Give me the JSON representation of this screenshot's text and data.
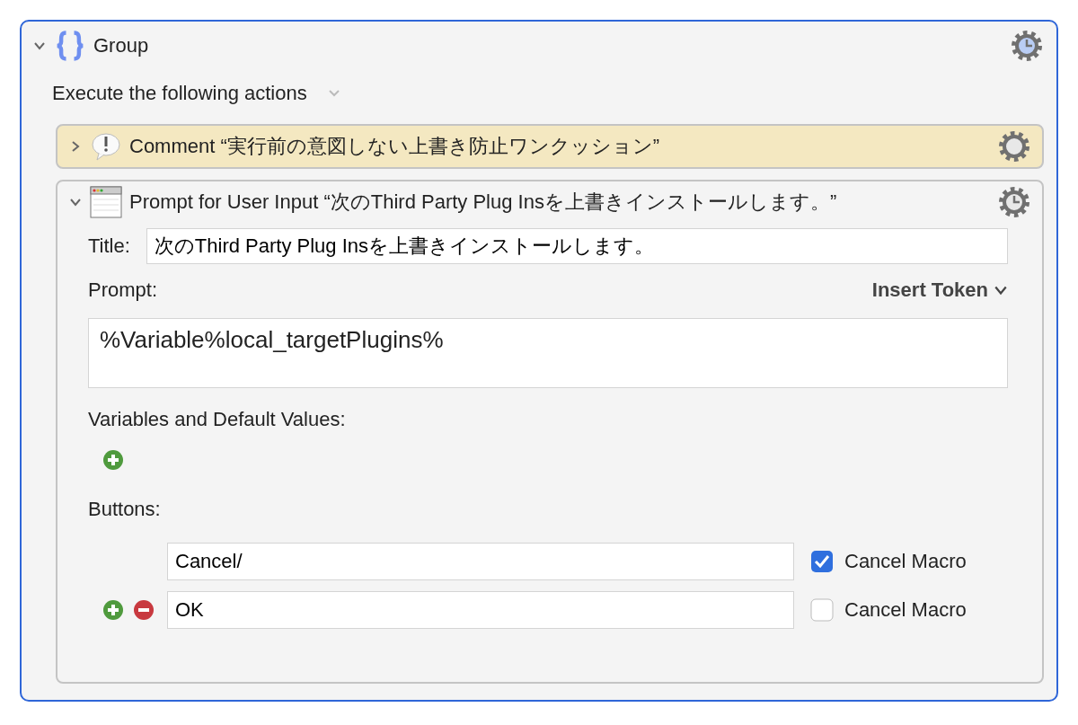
{
  "group": {
    "title": "Group",
    "expanded": true,
    "mode": "Execute the following actions"
  },
  "actions": [
    {
      "kind": "comment",
      "title": "Comment “実行前の意図しない上書き防止ワンクッション”",
      "expanded": false,
      "timed": false
    },
    {
      "kind": "prompt",
      "title": "Prompt for User Input “次のThird Party Plug Insを上書きインストールします。”",
      "expanded": true,
      "timed": true,
      "title_label": "Title:",
      "title_value": "次のThird Party Plug Insを上書きインストールします。",
      "prompt_label": "Prompt:",
      "insert_token": "Insert Token",
      "prompt_value": "%Variable%local_targetPlugins%",
      "variables_label": "Variables and Default Values:",
      "buttons_label": "Buttons:",
      "buttons": [
        {
          "value": "Cancel/",
          "cancel_macro": true,
          "option_label": "Cancel Macro",
          "edit_controls": false
        },
        {
          "value": "OK",
          "cancel_macro": false,
          "option_label": "Cancel Macro",
          "edit_controls": true
        }
      ]
    }
  ]
}
